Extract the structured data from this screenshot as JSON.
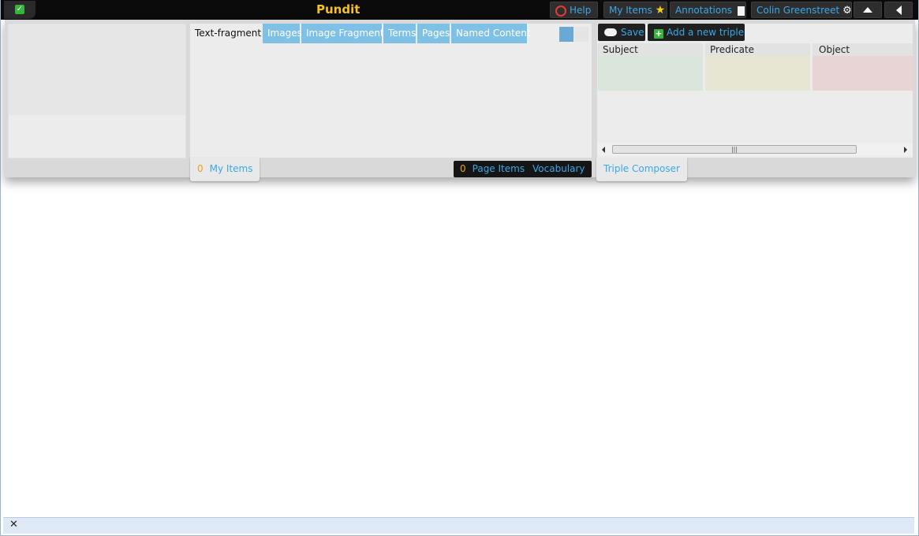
{
  "topbar": {
    "brand": "Pundit",
    "help": "Help",
    "my_items": "My Items",
    "annotations": "Annotations",
    "user": "Colin Greenstreet"
  },
  "tabs": [
    "Text-fragment",
    "Images",
    "Image Fragments",
    "Terms",
    "Pages",
    "Named Content"
  ],
  "footer": {
    "my_items_count": "0",
    "my_items_label": "My Items",
    "page_items_count": "0",
    "page_items_label": "Page Items",
    "vocabulary_label": "Vocabulary",
    "triple_composer_label": "Triple Composer"
  },
  "triple_composer": {
    "save_label": "Save",
    "add_label": "Add a new triple",
    "columns": [
      "Subject",
      "Predicate",
      "Object"
    ]
  },
  "colors": {
    "brand": "#f4c21c",
    "link": "#3aa7e8",
    "subject_bg": "#dae6dc",
    "predicate_bg": "#e6e6d3",
    "object_bg": "#e8d3d5"
  },
  "bottombar": {
    "close_glyph": "✕"
  }
}
